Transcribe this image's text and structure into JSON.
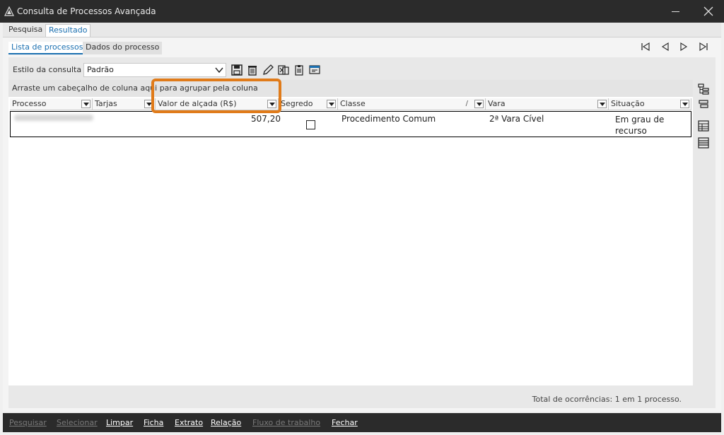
{
  "window": {
    "title": "Consulta de Processos Avançada"
  },
  "outer_tabs": [
    {
      "label": "Pesquisa",
      "active": false
    },
    {
      "label": "Resultado",
      "active": true
    }
  ],
  "inner_tabs": [
    {
      "label": "Lista de processos",
      "active": true
    },
    {
      "label": "Dados do processo",
      "active": false
    }
  ],
  "toolbar": {
    "style_label": "Estilo da consulta",
    "style_value": "Padrão",
    "icons": [
      "save-icon",
      "delete-icon",
      "edit-icon",
      "export-icon",
      "clipboard-icon",
      "window-icon"
    ]
  },
  "grid": {
    "group_hint": "Arraste um cabeçalho de coluna aqui para agrupar pela coluna",
    "columns": [
      "Processo",
      "Tarjas",
      "Valor de alçada (R$)",
      "Segredo",
      "Classe",
      "Vara",
      "Situação"
    ],
    "sort_glyph": "/",
    "row": {
      "processo": "",
      "tarjas": "",
      "valor": "507,20",
      "segredo_checked": false,
      "classe": "Procedimento Comum",
      "vara": "2ª Vara Cível",
      "situacao": "Em grau de recurso"
    },
    "highlight_color": "#e07b1a"
  },
  "total_text": "Total de ocorrências: 1 em 1 processo.",
  "bottom_bar": [
    {
      "label": "Pesquisar",
      "enabled": false
    },
    {
      "label": "Selecionar",
      "enabled": false
    },
    {
      "label": "Limpar",
      "enabled": true
    },
    {
      "label": "Ficha",
      "enabled": true
    },
    {
      "label": "Extrato",
      "enabled": true
    },
    {
      "label": "Relação",
      "enabled": true
    },
    {
      "label": "Fluxo de trabalho",
      "enabled": false
    },
    {
      "label": "Fechar",
      "enabled": true
    }
  ],
  "colors": {
    "titlebar": "#2b2b2b",
    "accent": "#1a6fb0",
    "highlight": "#e07b1a"
  }
}
